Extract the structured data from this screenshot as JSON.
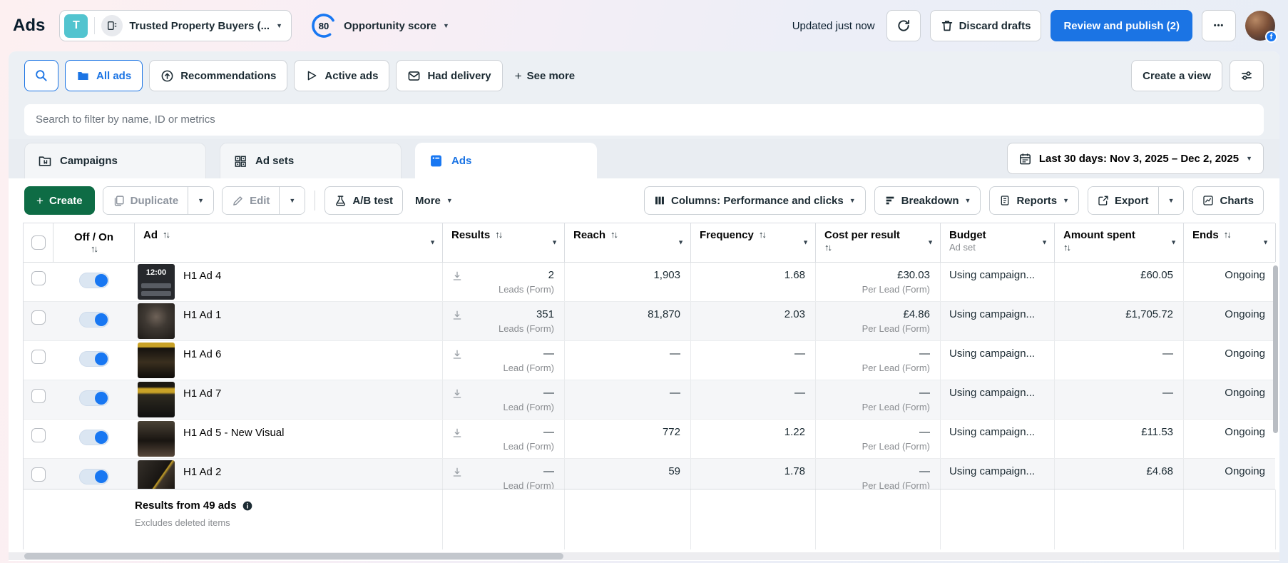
{
  "colors": {
    "accent_blue": "#1b74e4",
    "toggle_blue": "#1877f2",
    "create_green": "#0e6c45",
    "account_teal": "#52c4cf"
  },
  "icons": {
    "sort": "↑↓",
    "caret": "▼",
    "plus": "+",
    "dots": "•••"
  },
  "topbar": {
    "title": "Ads",
    "account": {
      "avatar_initial": "T",
      "name": "Trusted Property Buyers (..."
    },
    "opportunity": {
      "score": "80",
      "label": "Opportunity score"
    },
    "updated_status": "Updated just now",
    "discard_button": "Discard drafts",
    "publish_button": "Review and publish (2)",
    "avatar_badge": "f"
  },
  "filter_bar": {
    "chips": [
      {
        "label": "All ads",
        "selected": true
      },
      {
        "label": "Recommendations",
        "selected": false
      },
      {
        "label": "Active ads",
        "selected": false
      },
      {
        "label": "Had delivery",
        "selected": false
      }
    ],
    "see_more": "See more",
    "create_view_button": "Create a view"
  },
  "search": {
    "placeholder": "Search to filter by name, ID or metrics"
  },
  "level_tabs": [
    {
      "label": "Campaigns",
      "selected": false
    },
    {
      "label": "Ad sets",
      "selected": false
    },
    {
      "label": "Ads",
      "selected": true
    }
  ],
  "date_range": "Last 30 days: Nov 3, 2025 – Dec 2, 2025",
  "toolbar": {
    "create": "Create",
    "duplicate": "Duplicate",
    "edit": "Edit",
    "ab_test": "A/B test",
    "more": "More",
    "columns": "Columns: Performance and clicks",
    "breakdown": "Breakdown",
    "reports": "Reports",
    "export": "Export",
    "charts": "Charts"
  },
  "table": {
    "headers": {
      "off_on": "Off / On",
      "ad": "Ad",
      "results": "Results",
      "reach": "Reach",
      "frequency": "Frequency",
      "cost_per_result": "Cost per result",
      "budget": "Budget",
      "budget_sub": "Ad set",
      "amount_spent": "Amount spent",
      "ends": "Ends"
    },
    "rows": [
      {
        "name": "H1 Ad 4",
        "thumb_text": "12:00",
        "results": "2",
        "results_sub": "Leads (Form)",
        "reach": "1,903",
        "frequency": "1.68",
        "cost_per_result": "£30.03",
        "cpr_sub": "Per Lead (Form)",
        "budget": "Using campaign...",
        "amount_spent": "£60.05",
        "ends": "Ongoing"
      },
      {
        "name": "H1 Ad 1",
        "results": "351",
        "results_sub": "Leads (Form)",
        "reach": "81,870",
        "frequency": "2.03",
        "cost_per_result": "£4.86",
        "cpr_sub": "Per Lead (Form)",
        "budget": "Using campaign...",
        "amount_spent": "£1,705.72",
        "ends": "Ongoing"
      },
      {
        "name": "H1 Ad 6",
        "results": "—",
        "results_sub": "Lead (Form)",
        "reach": "—",
        "frequency": "—",
        "cost_per_result": "—",
        "cpr_sub": "Per Lead (Form)",
        "budget": "Using campaign...",
        "amount_spent": "—",
        "ends": "Ongoing"
      },
      {
        "name": "H1 Ad 7",
        "results": "—",
        "results_sub": "Lead (Form)",
        "reach": "—",
        "frequency": "—",
        "cost_per_result": "—",
        "cpr_sub": "Per Lead (Form)",
        "budget": "Using campaign...",
        "amount_spent": "—",
        "ends": "Ongoing"
      },
      {
        "name": "H1 Ad 5 - New Visual",
        "results": "—",
        "results_sub": "Lead (Form)",
        "reach": "772",
        "frequency": "1.22",
        "cost_per_result": "—",
        "cpr_sub": "Per Lead (Form)",
        "budget": "Using campaign...",
        "amount_spent": "£11.53",
        "ends": "Ongoing"
      },
      {
        "name": "H1 Ad 2",
        "results": "—",
        "results_sub": "Lead (Form)",
        "reach": "59",
        "frequency": "1.78",
        "cost_per_result": "—",
        "cpr_sub": "Per Lead (Form)",
        "budget": "Using campaign...",
        "amount_spent": "£4.68",
        "ends": "Ongoing"
      }
    ],
    "footer": {
      "summary": "Results from 49 ads",
      "note": "Excludes deleted items"
    }
  }
}
